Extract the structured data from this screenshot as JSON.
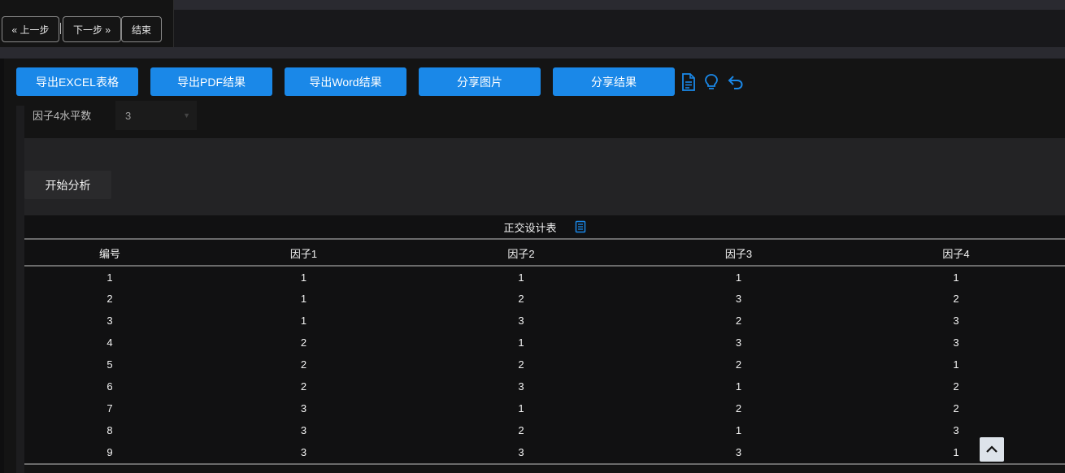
{
  "step_nav": {
    "prev_label": "« 上一步",
    "next_label": "下一步 »",
    "end_label": "结束"
  },
  "toolbar": {
    "export_excel": "导出EXCEL表格",
    "export_pdf": "导出PDF结果",
    "export_word": "导出Word结果",
    "share_image": "分享图片",
    "share_result": "分享结果",
    "icons": [
      "document-icon",
      "lightbulb-icon",
      "undo-icon"
    ],
    "accent_color": "#1a88e8"
  },
  "factor4": {
    "label": "因子4水平数",
    "value": "3"
  },
  "start_button": "开始分析",
  "table": {
    "title": "正交设计表",
    "headers": [
      "编号",
      "因子1",
      "因子2",
      "因子3",
      "因子4"
    ],
    "rows": [
      [
        "1",
        "1",
        "1",
        "1",
        "1"
      ],
      [
        "2",
        "1",
        "2",
        "3",
        "2"
      ],
      [
        "3",
        "1",
        "3",
        "2",
        "3"
      ],
      [
        "4",
        "2",
        "1",
        "3",
        "3"
      ],
      [
        "5",
        "2",
        "2",
        "2",
        "1"
      ],
      [
        "6",
        "2",
        "3",
        "1",
        "2"
      ],
      [
        "7",
        "3",
        "1",
        "2",
        "2"
      ],
      [
        "8",
        "3",
        "2",
        "1",
        "3"
      ],
      [
        "9",
        "3",
        "3",
        "3",
        "1"
      ]
    ]
  }
}
